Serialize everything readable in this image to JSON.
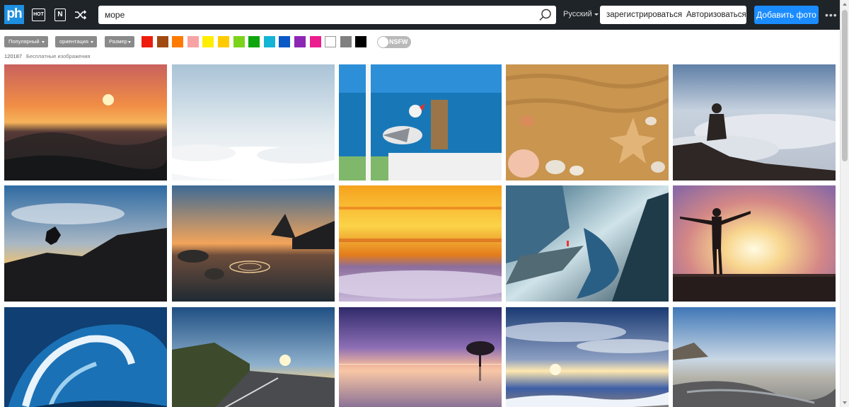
{
  "header": {
    "logo_text": "ph",
    "hot_label": "HOT",
    "new_label": "N",
    "search_value": "море",
    "search_placeholder": "",
    "language": "Русский",
    "register_label": "зарегистрироваться",
    "login_label": "Авторизоваться",
    "add_photo_label": "Добавить фото",
    "more_label": "•••",
    "icons": {
      "hot": "hot-icon",
      "new": "new-icon",
      "shuffle": "shuffle-icon",
      "search": "search-icon",
      "more": "more-icon"
    }
  },
  "filters": {
    "popular_label": "Популярный",
    "orientation_label": "ориентация",
    "size_label": "Размер",
    "colors": [
      "#ee1c0c",
      "#a04a13",
      "#ff7a00",
      "#f7a3a3",
      "#ffee00",
      "#ffcb00",
      "#7cd31b",
      "#0fa50f",
      "#13b4d5",
      "#0a59c7",
      "#8c26b5",
      "#ec1d8f",
      "#ffffff",
      "#808080",
      "#000000"
    ],
    "nsfw_label": "NSFW"
  },
  "results": {
    "count": "120187",
    "label": "Бесплатные изображения"
  },
  "photos": [
    {
      "subject": "sunset over ocean waves"
    },
    {
      "subject": "clouds below pale sky"
    },
    {
      "subject": "seagull on pier railing"
    },
    {
      "subject": "seashells and starfish on sand"
    },
    {
      "subject": "man sitting above clouds"
    },
    {
      "subject": "person jumping silhouette at sunset"
    },
    {
      "subject": "rocks in water at sunset"
    },
    {
      "subject": "orange sunset above sea of clouds"
    },
    {
      "subject": "person on cliff above fjord"
    },
    {
      "subject": "woman silhouette at sunset on pier"
    },
    {
      "subject": "crashing blue wave"
    },
    {
      "subject": "coastal road at sunset"
    },
    {
      "subject": "purple sunset with lone tree"
    },
    {
      "subject": "sunlit beach with waves"
    },
    {
      "subject": "rocky coastline at dusk"
    }
  ],
  "colors": {
    "header_bg": "#1f2429",
    "accent": "#1a8cff",
    "logo_bg": "#1e8fe0"
  }
}
